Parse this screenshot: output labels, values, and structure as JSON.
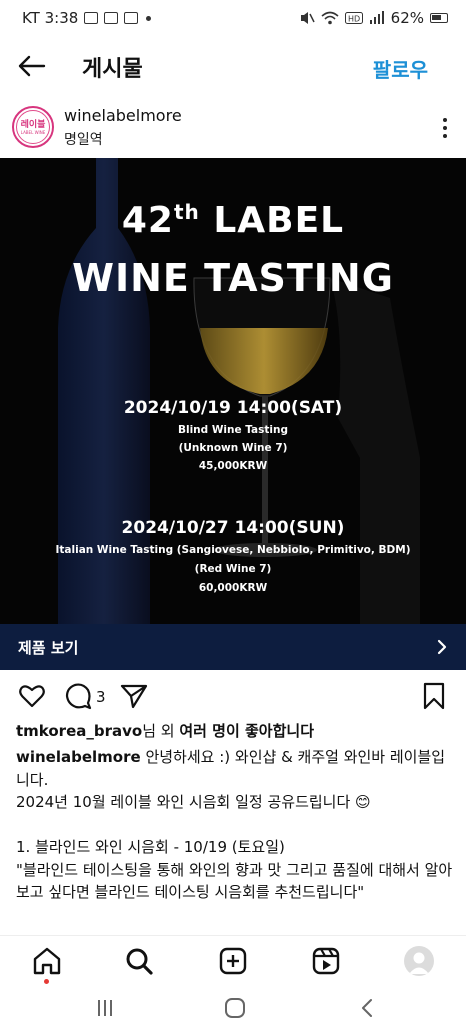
{
  "status_bar": {
    "time": "KT 3:38",
    "battery": "62%"
  },
  "header": {
    "title": "게시물",
    "follow_label": "팔로우"
  },
  "account": {
    "username": "winelabelmore",
    "location": "명일역",
    "avatar_text": "레이블",
    "avatar_subtext": "LABEL WINE"
  },
  "post": {
    "title_number": "42",
    "title_suffix": "th",
    "title_word": "LABEL",
    "subtitle": "WINE TASTING",
    "event1": {
      "date": "2024/10/19 14:00(SAT)",
      "line1": "Blind Wine Tasting",
      "line2": "(Unknown Wine 7)",
      "price": "45,000KRW"
    },
    "event2": {
      "date": "2024/10/27 14:00(SUN)",
      "line1": "Italian Wine Tasting (Sangiovese, Nebbiolo, Primitivo, BDM)",
      "line2": "(Red Wine 7)",
      "price": "60,000KRW"
    }
  },
  "product_bar": {
    "label": "제품 보기"
  },
  "actions": {
    "comment_count": "3"
  },
  "likes": {
    "user": "tmkorea_bravo",
    "text_mid": "님 외 ",
    "text_bold": "여러 명이 좋아합니다"
  },
  "caption": {
    "username": "winelabelmore",
    "text": " 안녕하세요 :) 와인샵 & 캐주얼 와인바 레이블입니다.\n2024년 10월 레이블 와인 시음회 일정 공유드립니다 😊\n\n1. 블라인드 와인 시음회 - 10/19 (토요일)\n\"블라인드 테이스팅을 통해 와인의 향과 맛 그리고 품질에 대해서 알아보고 싶다면 블라인드 테이스팅 시음회를 추천드립니다\""
  },
  "colors": {
    "accent": "#1d90d6",
    "product_bar": "#0d1d3f",
    "post_bg": "#050505",
    "notification_dot": "#e53935"
  },
  "icons": {
    "back": "arrow-left-icon",
    "more": "more-vertical-icon",
    "like": "heart-icon",
    "comment": "comment-icon",
    "share": "send-icon",
    "save": "bookmark-icon",
    "chevron": "chevron-right-icon",
    "home": "home-icon",
    "search": "search-icon",
    "create": "plus-square-icon",
    "reels": "reels-icon",
    "profile": "profile-avatar"
  }
}
